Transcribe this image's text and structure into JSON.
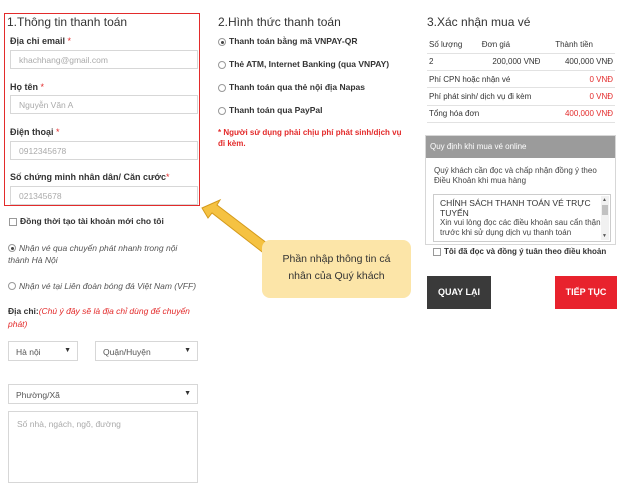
{
  "sections": {
    "customer_info": "1.Thông tin thanh toán",
    "payment_method": "2.Hình thức thanh toán",
    "confirm": "3.Xác nhận mua vé"
  },
  "form": {
    "email_label": "Địa chỉ email",
    "email_value": "khachhang@gmail.com",
    "name_label": "Họ tên",
    "name_value": "Nguyễn Văn A",
    "phone_label": "Điện thoại",
    "phone_value": "0912345678",
    "id_label": "Số chứng minh nhân dân/ Căn cước",
    "id_value": "021345678",
    "required_mark": "*",
    "create_account_label": "Đồng thời tạo tài khoản mới cho tôi",
    "delivery_option_1": "Nhận vé qua chuyển phát nhanh trong nội thành Hà Nội",
    "delivery_option_2": "Nhận vé tại Liên đoàn bóng đá Việt Nam (VFF)",
    "address_label": "Địa chỉ:",
    "address_note": "(Chú ý đây sẽ là địa chỉ dùng để chuyển phát)",
    "city_value": "Hà nội",
    "district_placeholder": "Quận/Huyện",
    "ward_placeholder": "Phường/Xã",
    "street_placeholder": "Số nhà, ngách, ngõ, đường"
  },
  "payment": {
    "options": [
      "Thanh toán bằng mã VNPAY-QR",
      "Thẻ ATM, Internet Banking (qua VNPAY)",
      "Thanh toán qua thẻ nội địa Napas",
      "Thanh toán qua PayPal"
    ],
    "selected_index": 0,
    "note": "* Người sử dụng phải chịu phí phát sinh/dịch vụ đi kèm."
  },
  "summary": {
    "headers": [
      "Số lượng",
      "Đơn giá",
      "Thành tiền"
    ],
    "row": [
      "2",
      "200,000 VNĐ",
      "400,000 VNĐ"
    ],
    "cpn_fee_label": "Phí CPN hoặc nhận vé",
    "cpn_fee_value": "0 VNĐ",
    "extra_fee_label": "Phí phát sinh/ dịch vụ đi kèm",
    "extra_fee_value": "0 VNĐ",
    "total_label": "Tổng hóa đơn",
    "total_value": "400,000 VNĐ"
  },
  "rules": {
    "header": "Quy định khi mua vé online",
    "intro": "Quý khách cần đọc và chấp nhận đồng ý theo Điều Khoản khi mua hàng",
    "policy_title": "CHÍNH SÁCH THANH TOÁN VÉ TRỰC TUYẾN",
    "policy_body": "Xin vui lòng đọc các điều khoản sau cẩn thận trước khi sử dụng dịch vụ thanh toán",
    "agree_label": "Tôi đã đọc và đồng ý tuân theo điều khoản"
  },
  "buttons": {
    "back": "QUAY LẠI",
    "next": "TIẾP TỤC"
  },
  "callout": {
    "text_line1": "Phần nhập thông tin cá",
    "text_line2": "nhân của Quý khách"
  },
  "colors": {
    "accent_red": "#e32b2b",
    "callout_bg": "#fce5a8",
    "arrow_fill": "#f5c242"
  }
}
